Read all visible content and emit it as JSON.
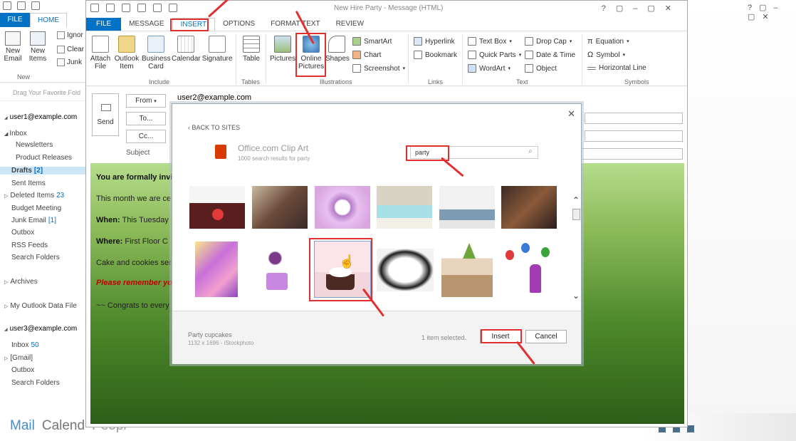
{
  "outer": {
    "tabs": {
      "file": "FILE",
      "home": "HOME"
    },
    "ribbon": {
      "new_email": "New Email",
      "new_items": "New Items",
      "ignore": "Ignor",
      "clean_up": "Clear",
      "junk": "Junk",
      "group_new": "New",
      "favorites_hint": "Drag Your Favorite Fold"
    },
    "accounts": {
      "account1": "user1@example.com",
      "account3": "user3@example.com"
    },
    "folders": {
      "inbox": "Inbox",
      "newsletters": "Newsletters",
      "product_releases": "Product Releases",
      "drafts": "Drafts",
      "drafts_count": "[2]",
      "sent": "Sent Items",
      "deleted": "Deleted Items",
      "deleted_count": "23",
      "budget": "Budget Meeting",
      "junk": "Junk Email",
      "junk_count": "[1]",
      "outbox": "Outbox",
      "rss": "RSS Feeds",
      "search": "Search Folders",
      "archives": "Archives",
      "my_data": "My Outlook Data File",
      "inbox3": "Inbox",
      "inbox3_count": "50",
      "gmail": "[Gmail]",
      "outbox3": "Outbox",
      "search3": "Search Folders"
    },
    "nav": {
      "mail": "Mail",
      "calendar": "Calend",
      "people": "Peopl"
    }
  },
  "message": {
    "title": "New Hire Party - Message (HTML)",
    "tabs": [
      "FILE",
      "MESSAGE",
      "INSERT",
      "OPTIONS",
      "FORMAT TEXT",
      "REVIEW"
    ],
    "ribbon": {
      "attach_file": "Attach File",
      "outlook_item": "Outlook Item",
      "business_card": "Business Card",
      "calendar": "Calendar",
      "signature": "Signature",
      "group_include": "Include",
      "table": "Table",
      "group_tables": "Tables",
      "pictures": "Pictures",
      "online_pictures": "Online Pictures",
      "shapes": "Shapes",
      "smartart": "SmartArt",
      "chart": "Chart",
      "screenshot": "Screenshot",
      "group_illustrations": "Illustrations",
      "hyperlink": "Hyperlink",
      "bookmark": "Bookmark",
      "group_links": "Links",
      "text_box": "Text Box",
      "quick_parts": "Quick Parts",
      "wordart": "WordArt",
      "drop_cap": "Drop Cap",
      "date_time": "Date & Time",
      "object": "Object",
      "group_text": "Text",
      "equation": "Equation",
      "symbol": "Symbol",
      "horizontal_line": "Horizontal Line",
      "group_symbols": "Symbols"
    },
    "send": "Send",
    "from": "From",
    "to": "To...",
    "cc": "Cc...",
    "subject_label": "Subject",
    "from_value": "user2@example.com",
    "body": {
      "line1": "You are formally invi",
      "line2": "This month we are ce",
      "line3_label": "When:",
      "line3_value": "This Tuesday",
      "line4_label": "Where:",
      "line4_value": "First Floor C",
      "line5": "Cake and cookies ser",
      "line6": "Please remember you",
      "line7": "~~ Congrats to every"
    }
  },
  "dialog": {
    "back": "‹ BACK TO SITES",
    "provider": "Office.com Clip Art",
    "results": "1000 search results for party",
    "search_value": "party",
    "selected_name": "Party cupcakes",
    "selected_meta": "1132 x 1696 - iStockphoto",
    "selected_count": "1 item selected.",
    "insert": "Insert",
    "cancel": "Cancel"
  },
  "colors": {
    "accent": "#0072c6",
    "annotation": "#e03030",
    "body_top": "#b5dc8c",
    "body_bottom": "#2e5e18"
  }
}
